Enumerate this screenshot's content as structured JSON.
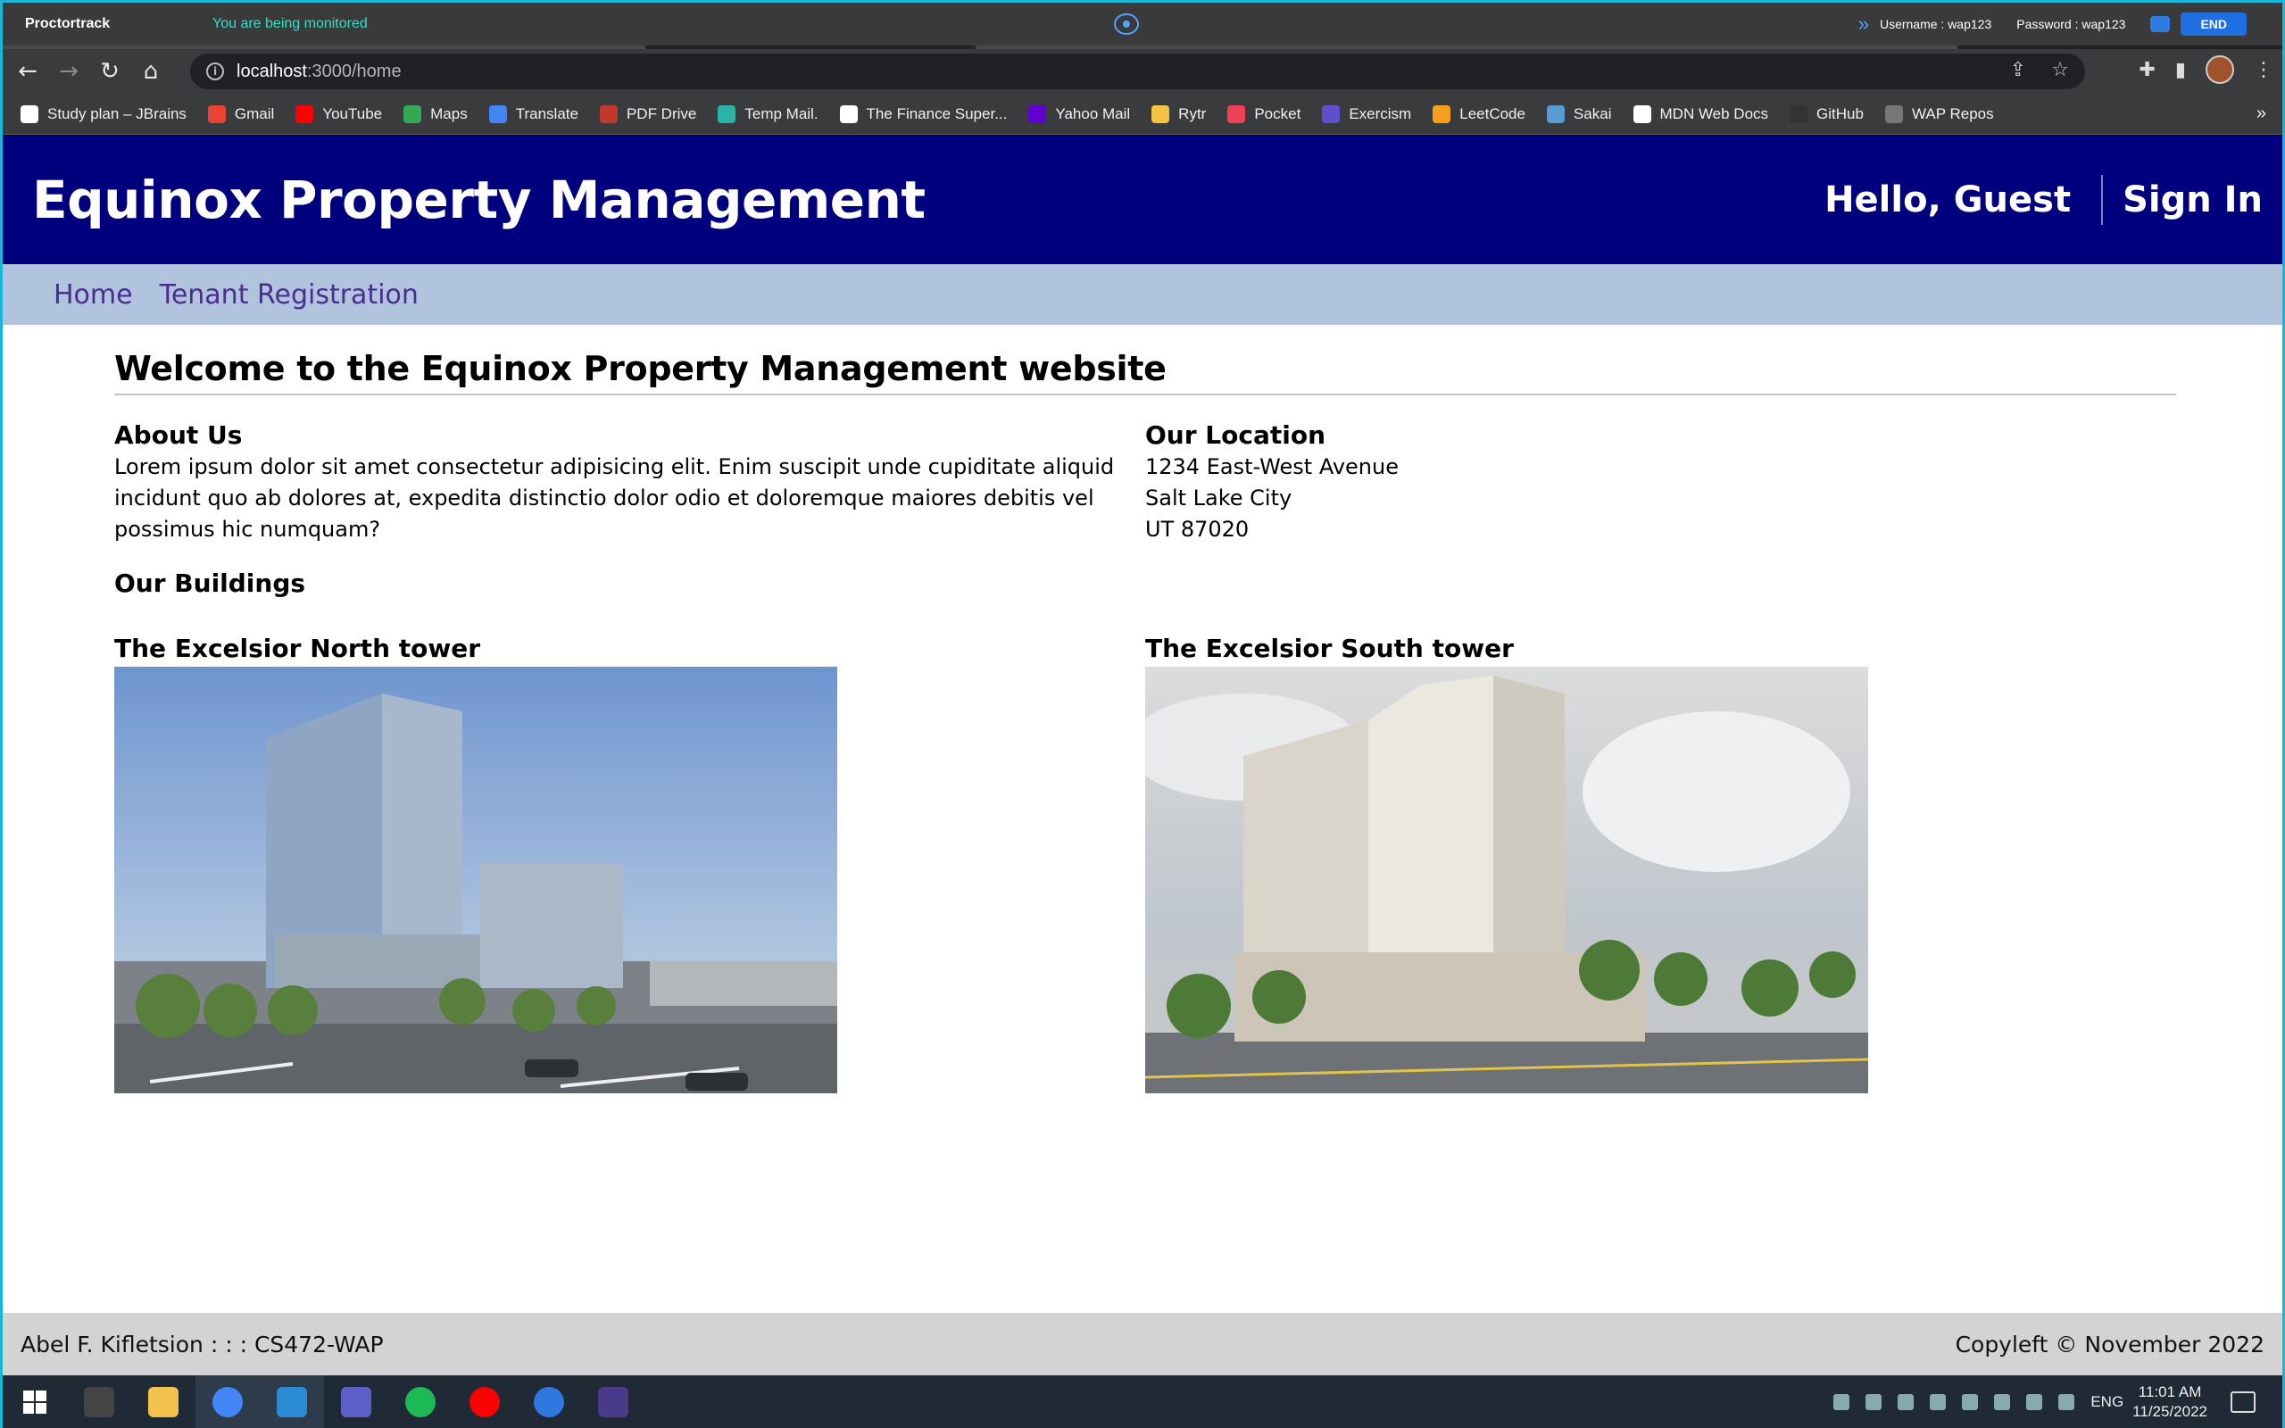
{
  "proctor": {
    "brand": "Proctortrack",
    "status": "You are being monitored",
    "username": "Username : wap123",
    "password": "Password : wap123",
    "end_label": "END"
  },
  "browser": {
    "url_host": "localhost",
    "url_path": ":3000/home",
    "bookmarks": [
      {
        "label": "Study plan – JBrains",
        "color": "#ffffff"
      },
      {
        "label": "Gmail",
        "color": "#ea4335"
      },
      {
        "label": "YouTube",
        "color": "#ff0000"
      },
      {
        "label": "Maps",
        "color": "#34a853"
      },
      {
        "label": "Translate",
        "color": "#4285f4"
      },
      {
        "label": "PDF Drive",
        "color": "#c0392b"
      },
      {
        "label": "Temp Mail.",
        "color": "#2bb3a6"
      },
      {
        "label": "The Finance Super...",
        "color": "#ffffff"
      },
      {
        "label": "Yahoo Mail",
        "color": "#6001d2"
      },
      {
        "label": "Rytr",
        "color": "#f5c242"
      },
      {
        "label": "Pocket",
        "color": "#ef4056"
      },
      {
        "label": "Exercism",
        "color": "#604fcd"
      },
      {
        "label": "LeetCode",
        "color": "#f89f1b"
      },
      {
        "label": "Sakai",
        "color": "#5b9bd5"
      },
      {
        "label": "MDN Web Docs",
        "color": "#ffffff"
      },
      {
        "label": "GitHub",
        "color": "#333333"
      },
      {
        "label": "WAP Repos",
        "color": "#777777"
      }
    ],
    "more": "»"
  },
  "site": {
    "title": "Equinox Property Management",
    "greeting": "Hello, Guest",
    "sign_in": "Sign In",
    "nav": [
      "Home",
      "Tenant Registration"
    ],
    "welcome": "Welcome to the Equinox Property Management website",
    "about_title": "About Us",
    "about_text": "Lorem ipsum dolor sit amet consectetur adipisicing elit. Enim suscipit unde cupiditate aliquid incidunt quo ab dolores at, expedita distinctio dolor odio et doloremque maiores debitis vel possimus hic numquam?",
    "location_title": "Our Location",
    "address": [
      "1234 East-West Avenue",
      "Salt Lake City",
      "UT 87020"
    ],
    "buildings_title": "Our Buildings",
    "buildings": [
      {
        "name": "The Excelsior North tower"
      },
      {
        "name": "The Excelsior South tower"
      }
    ],
    "footer_left": "Abel F. Kifletsion : : : CS472-WAP",
    "footer_right": "Copyleft © November 2022"
  },
  "taskbar": {
    "apps": [
      {
        "name": "terminal",
        "color": "#444444"
      },
      {
        "name": "file-explorer",
        "color": "#f2c14e"
      },
      {
        "name": "chrome",
        "color": "#4285f4"
      },
      {
        "name": "vscode",
        "color": "#2a8ad4"
      },
      {
        "name": "teams",
        "color": "#5b5fc7"
      },
      {
        "name": "spotify",
        "color": "#1db954"
      },
      {
        "name": "youtube-music",
        "color": "#ff0000"
      },
      {
        "name": "firefox",
        "color": "#2f78e0"
      },
      {
        "name": "proctortrack",
        "color": "#4a3a8a"
      }
    ],
    "lang": "ENG",
    "time": "11:01 AM",
    "date": "11/25/2022"
  }
}
